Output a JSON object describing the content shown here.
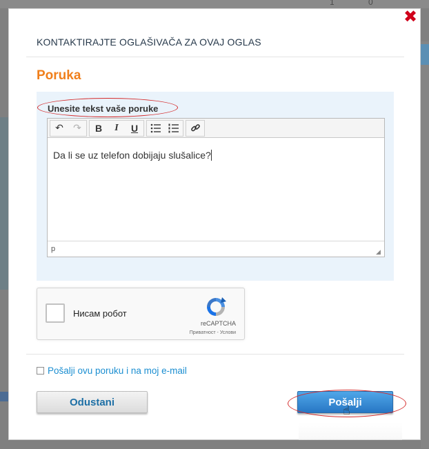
{
  "background": {
    "counters": [
      "1",
      "0"
    ]
  },
  "modal": {
    "title": "KONTAKTIRAJTE OGLAŠIVAČA ZA OVAJ OGLAS",
    "close_glyph": "✖",
    "section_title": "Poruka",
    "compose": {
      "label": "Unesite tekst vaše poruke",
      "toolbar": {
        "undo": "↶",
        "redo": "↷",
        "bold": "B",
        "italic": "I",
        "underline": "U",
        "bullet_list": "☰",
        "numbered_list": "☰",
        "link": "🔗"
      },
      "text": "Da li se uz telefon dobijaju slušalice?",
      "status_path": "p"
    },
    "recaptcha": {
      "checkbox_label": "Нисам робот",
      "brand": "reCAPTCHA",
      "links": "Приватност - Услови"
    },
    "email_copy_label": "Pošalji ovu poruku i na moj e-mail",
    "cancel_label": "Odustani",
    "send_label": "Pošalji"
  },
  "colors": {
    "accent_orange": "#f07f1b",
    "link_blue": "#1b8ed1",
    "primary_button": "#2877c4",
    "close_red": "#d0021b",
    "annotation_red": "#d42a2a"
  }
}
